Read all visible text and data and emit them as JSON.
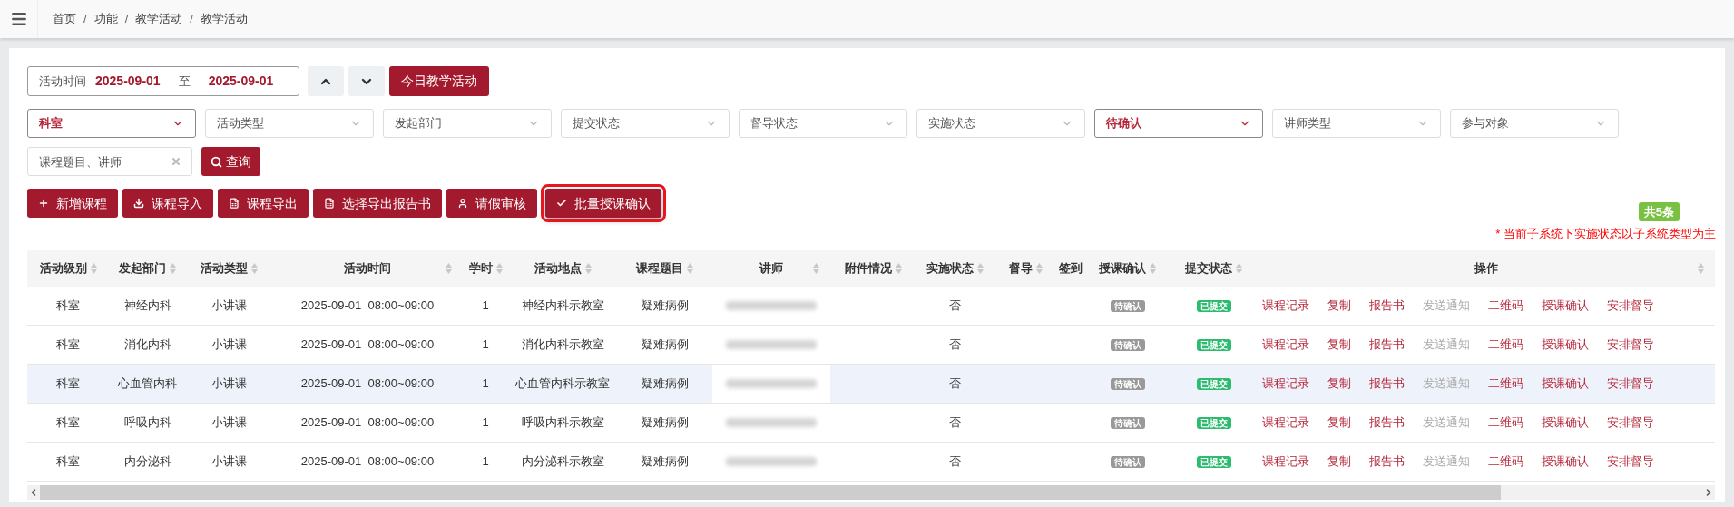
{
  "breadcrumb": {
    "separator": "/",
    "items": [
      "首页",
      "功能",
      "教学活动",
      "教学活动"
    ]
  },
  "date_range": {
    "label": "活动时间",
    "start": "2025-09-01",
    "separator": "至",
    "end": "2025-09-01"
  },
  "today_button": "今日教学活动",
  "filters": [
    {
      "kind": "value",
      "text": "科室"
    },
    {
      "kind": "placeholder",
      "text": "活动类型"
    },
    {
      "kind": "placeholder",
      "text": "发起部门"
    },
    {
      "kind": "placeholder",
      "text": "提交状态"
    },
    {
      "kind": "placeholder",
      "text": "督导状态"
    },
    {
      "kind": "placeholder",
      "text": "实施状态"
    },
    {
      "kind": "value",
      "text": "待确认"
    },
    {
      "kind": "placeholder",
      "text": "讲师类型"
    },
    {
      "kind": "placeholder",
      "text": "参与对象"
    }
  ],
  "search": {
    "placeholder": "课程题目、讲师",
    "button": "查询"
  },
  "actions": [
    {
      "kind": "plus",
      "label": "新增课程",
      "selected": false
    },
    {
      "kind": "download",
      "label": "课程导入",
      "selected": false
    },
    {
      "kind": "excel",
      "label": "课程导出",
      "selected": false
    },
    {
      "kind": "excel",
      "label": "选择导出报告书",
      "selected": false
    },
    {
      "kind": "user",
      "label": "请假审核",
      "selected": false
    },
    {
      "kind": "check",
      "label": "批量授课确认",
      "selected": true
    }
  ],
  "count_badge": "共5条",
  "note": "* 当前子系统下实施状态以子系统类型为主",
  "table": {
    "columns": [
      {
        "label": "活动级别",
        "sortable": true
      },
      {
        "label": "发起部门",
        "sortable": true
      },
      {
        "label": "活动类型",
        "sortable": true
      },
      {
        "label": "活动时间",
        "sortable": true
      },
      {
        "label": "学时",
        "sortable": true
      },
      {
        "label": "活动地点",
        "sortable": true
      },
      {
        "label": "课程题目",
        "sortable": true
      },
      {
        "label": "讲师",
        "sortable": true
      },
      {
        "label": "附件情况",
        "sortable": true
      },
      {
        "label": "实施状态",
        "sortable": true
      },
      {
        "label": "督导",
        "sortable": true
      },
      {
        "label": "签到",
        "sortable": false
      },
      {
        "label": "授课确认",
        "sortable": true
      },
      {
        "label": "提交状态",
        "sortable": true
      },
      {
        "label": "操作",
        "sortable": true
      }
    ],
    "rows": [
      {
        "selected": false,
        "level": "科室",
        "department": "神经内科",
        "type": "小讲课",
        "time": "2025-09-01  08:00~09:00",
        "hours": "1",
        "location": "神经内科示教室",
        "title": "疑难病例",
        "implemented": "否",
        "confirm": "待确认",
        "submit": "已提交",
        "ops": [
          {
            "label": "课程记录",
            "disabled": false
          },
          {
            "label": "复制",
            "disabled": false
          },
          {
            "label": "报告书",
            "disabled": false
          },
          {
            "label": "发送通知",
            "disabled": true
          },
          {
            "label": "二维码",
            "disabled": false
          },
          {
            "label": "授课确认",
            "disabled": false
          },
          {
            "label": "安排督导",
            "disabled": false
          }
        ]
      },
      {
        "selected": false,
        "level": "科室",
        "department": "消化内科",
        "type": "小讲课",
        "time": "2025-09-01  08:00~09:00",
        "hours": "1",
        "location": "消化内科示教室",
        "title": "疑难病例",
        "implemented": "否",
        "confirm": "待确认",
        "submit": "已提交",
        "ops": [
          {
            "label": "课程记录",
            "disabled": false
          },
          {
            "label": "复制",
            "disabled": false
          },
          {
            "label": "报告书",
            "disabled": false
          },
          {
            "label": "发送通知",
            "disabled": true
          },
          {
            "label": "二维码",
            "disabled": false
          },
          {
            "label": "授课确认",
            "disabled": false
          },
          {
            "label": "安排督导",
            "disabled": false
          }
        ]
      },
      {
        "selected": true,
        "level": "科室",
        "department": "心血管内科",
        "type": "小讲课",
        "time": "2025-09-01  08:00~09:00",
        "hours": "1",
        "location": "心血管内科示教室",
        "title": "疑难病例",
        "implemented": "否",
        "confirm": "待确认",
        "submit": "已提交",
        "ops": [
          {
            "label": "课程记录",
            "disabled": false
          },
          {
            "label": "复制",
            "disabled": false
          },
          {
            "label": "报告书",
            "disabled": false
          },
          {
            "label": "发送通知",
            "disabled": true
          },
          {
            "label": "二维码",
            "disabled": false
          },
          {
            "label": "授课确认",
            "disabled": false
          },
          {
            "label": "安排督导",
            "disabled": false
          }
        ]
      },
      {
        "selected": false,
        "level": "科室",
        "department": "呼吸内科",
        "type": "小讲课",
        "time": "2025-09-01  08:00~09:00",
        "hours": "1",
        "location": "呼吸内科示教室",
        "title": "疑难病例",
        "implemented": "否",
        "confirm": "待确认",
        "submit": "已提交",
        "ops": [
          {
            "label": "课程记录",
            "disabled": false
          },
          {
            "label": "复制",
            "disabled": false
          },
          {
            "label": "报告书",
            "disabled": false
          },
          {
            "label": "发送通知",
            "disabled": true
          },
          {
            "label": "二维码",
            "disabled": false
          },
          {
            "label": "授课确认",
            "disabled": false
          },
          {
            "label": "安排督导",
            "disabled": false
          }
        ]
      },
      {
        "selected": false,
        "level": "科室",
        "department": "内分泌科",
        "type": "小讲课",
        "time": "2025-09-01  08:00~09:00",
        "hours": "1",
        "location": "内分泌科示教室",
        "title": "疑难病例",
        "implemented": "否",
        "confirm": "待确认",
        "submit": "已提交",
        "ops": [
          {
            "label": "课程记录",
            "disabled": false
          },
          {
            "label": "复制",
            "disabled": false
          },
          {
            "label": "报告书",
            "disabled": false
          },
          {
            "label": "发送通知",
            "disabled": true
          },
          {
            "label": "二维码",
            "disabled": false
          },
          {
            "label": "授课确认",
            "disabled": false
          },
          {
            "label": "安排督导",
            "disabled": false
          }
        ]
      }
    ]
  }
}
